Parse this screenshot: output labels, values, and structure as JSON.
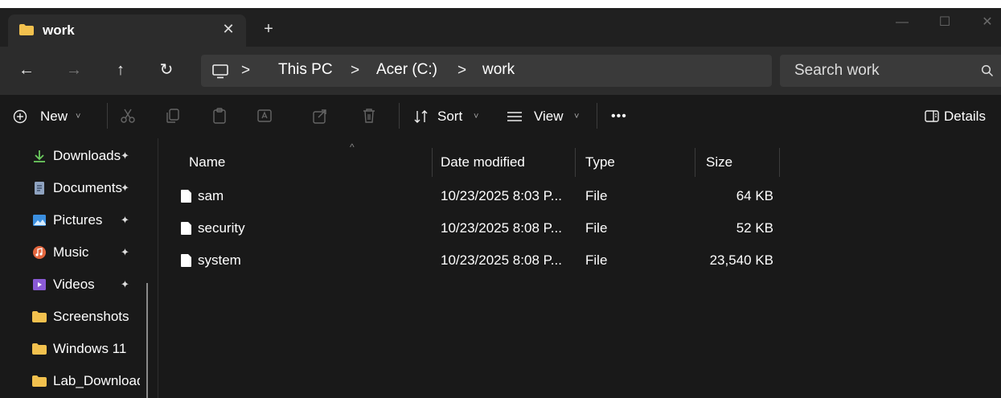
{
  "window": {
    "tab_title": "work",
    "tab_close": "✕",
    "new_tab": "+",
    "controls": {
      "minimize": "—",
      "maximize": "☐",
      "close": "✕"
    }
  },
  "nav": {
    "back": "←",
    "forward": "→",
    "up": "↑",
    "refresh": "↻",
    "breadcrumbs": [
      "This PC",
      "Acer (C:)",
      "work"
    ],
    "separator": ">",
    "search_placeholder": "Search work"
  },
  "toolbar": {
    "new_label": "New",
    "sort_label": "Sort",
    "view_label": "View",
    "more_label": "•••",
    "details_label": "Details",
    "chevron": "˅"
  },
  "sidebar": {
    "pin": "📌",
    "items": [
      {
        "label": "Downloads",
        "icon": "download-icon",
        "pinned": true
      },
      {
        "label": "Documents",
        "icon": "document-icon",
        "pinned": true
      },
      {
        "label": "Pictures",
        "icon": "pictures-icon",
        "pinned": true
      },
      {
        "label": "Music",
        "icon": "music-icon",
        "pinned": true
      },
      {
        "label": "Videos",
        "icon": "videos-icon",
        "pinned": true
      },
      {
        "label": "Screenshots",
        "icon": "folder-icon",
        "pinned": false
      },
      {
        "label": "Windows 11",
        "icon": "folder-icon",
        "pinned": false
      },
      {
        "label": "Lab_Downloads",
        "icon": "folder-icon",
        "pinned": false
      }
    ]
  },
  "files": {
    "columns": {
      "name": "Name",
      "date": "Date modified",
      "type": "Type",
      "size": "Size"
    },
    "rows": [
      {
        "name": "sam",
        "date": "10/23/2025 8:03 P...",
        "type": "File",
        "size": "64 KB"
      },
      {
        "name": "security",
        "date": "10/23/2025 8:08 P...",
        "type": "File",
        "size": "52 KB"
      },
      {
        "name": "system",
        "date": "10/23/2025 8:08 P...",
        "type": "File",
        "size": "23,540 KB"
      }
    ]
  },
  "colors": {
    "folder": "#f2c14e",
    "window_bg": "#191919",
    "bar_bg": "#2c2c2c",
    "accent_green": "#6ccb5f"
  }
}
